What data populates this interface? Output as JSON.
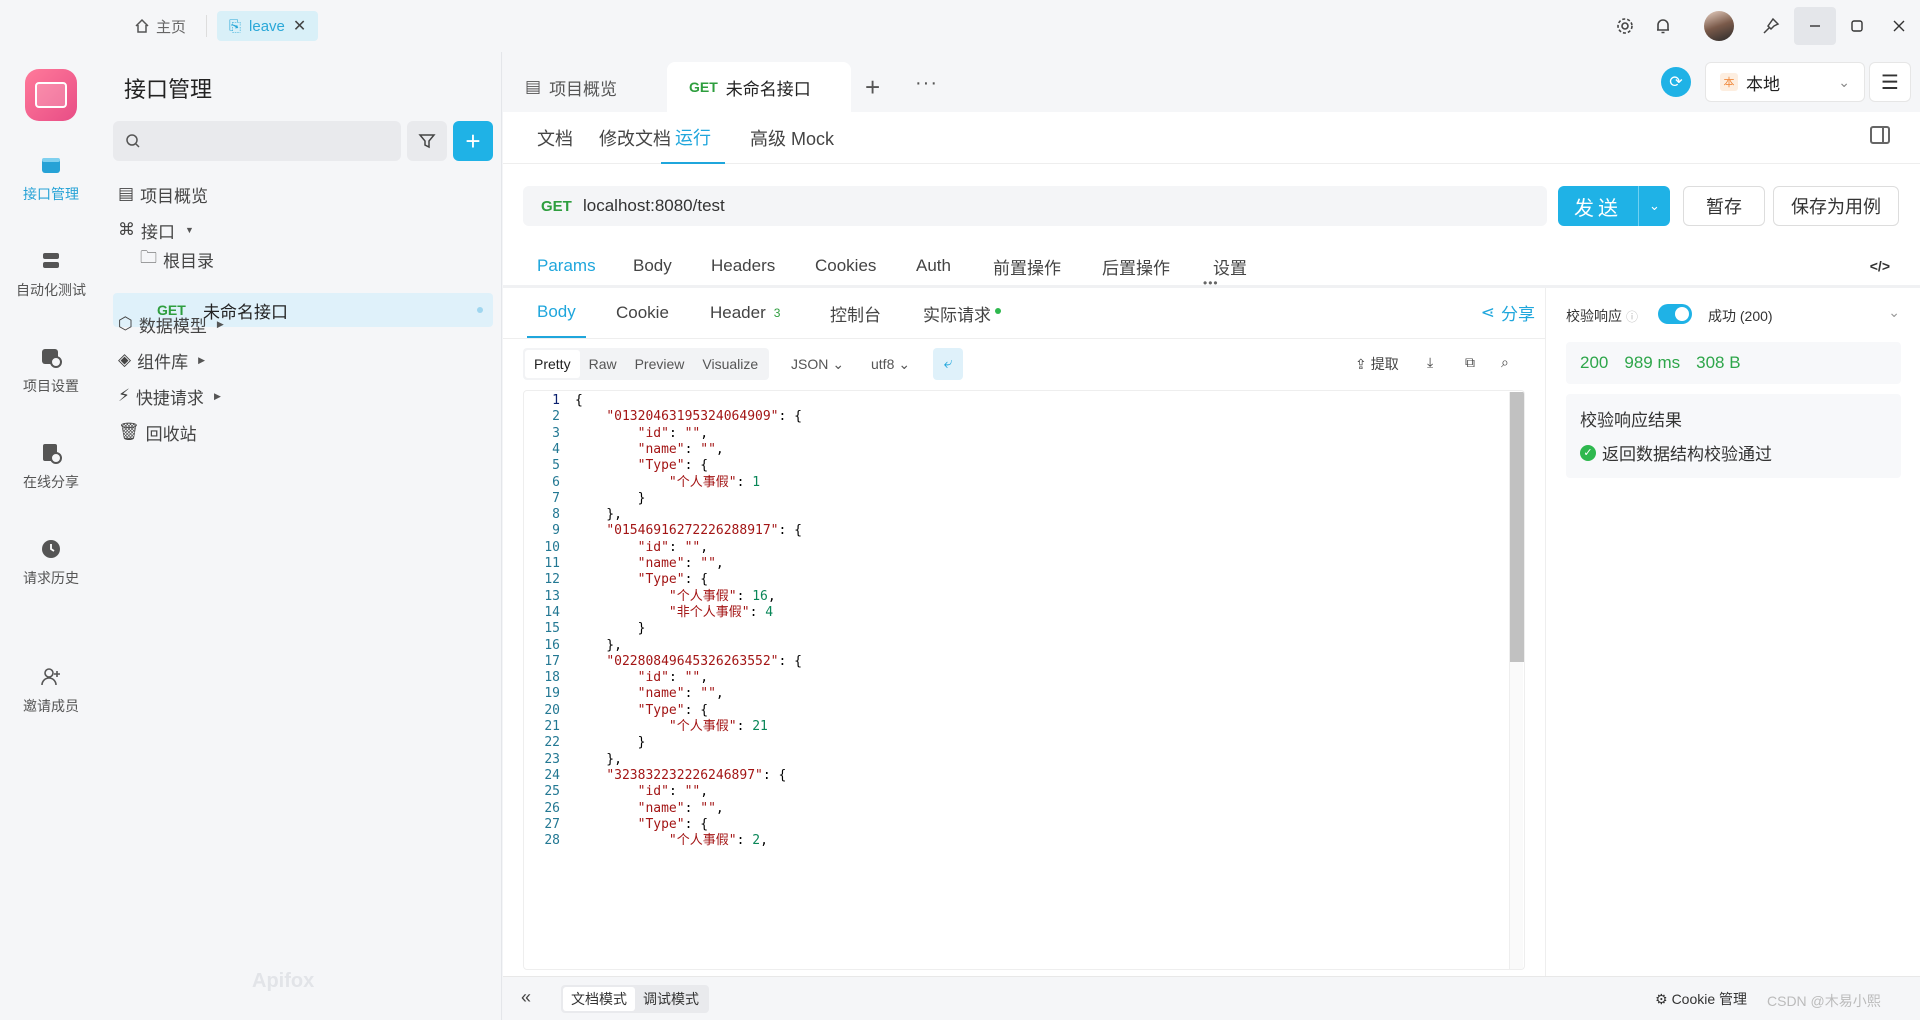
{
  "titlebar": {
    "home_label": "主页",
    "tab_label": "leave",
    "tab_close": "✕"
  },
  "leftnav": {
    "items": [
      {
        "label": "接口管理",
        "icon": "api-icon"
      },
      {
        "label": "自动化测试",
        "icon": "automation-icon"
      },
      {
        "label": "项目设置",
        "icon": "project-settings-icon"
      },
      {
        "label": "在线分享",
        "icon": "share-doc-icon"
      },
      {
        "label": "请求历史",
        "icon": "history-icon"
      },
      {
        "label": "邀请成员",
        "icon": "invite-user-icon"
      }
    ]
  },
  "sidebar": {
    "title": "接口管理",
    "search_placeholder": "",
    "add_label": "+",
    "tree": [
      {
        "label": "项目概览"
      },
      {
        "label": "接口"
      },
      {
        "label": "根目录"
      },
      {
        "label": "数据模型"
      },
      {
        "label": "组件库"
      },
      {
        "label": "快捷请求"
      },
      {
        "label": "回收站"
      }
    ],
    "selected": {
      "method": "GET",
      "name": "未命名接口"
    },
    "watermark": "Apifox"
  },
  "topbar": {
    "tab_overview": "项目概览",
    "tab_active_method": "GET",
    "tab_active_name": "未命名接口",
    "plus": "+",
    "more": "···",
    "env": {
      "badge": "本",
      "label": "本地"
    }
  },
  "subtabs": [
    "文档",
    "修改文档",
    "运行",
    "高级 Mock"
  ],
  "request": {
    "method": "GET",
    "url": "localhost:8080/test",
    "send": "发送",
    "save_temp": "暂存",
    "save_case": "保存为用例"
  },
  "reqtabs": [
    "Params",
    "Body",
    "Headers",
    "Cookies",
    "Auth",
    "前置操作",
    "后置操作",
    "设置"
  ],
  "response": {
    "tabs": [
      "Body",
      "Cookie",
      "Header",
      "控制台",
      "实际请求"
    ],
    "header_count": "3",
    "share": "分享",
    "formats": [
      "Pretty",
      "Raw",
      "Preview",
      "Visualize"
    ],
    "lang": "JSON",
    "encoding": "utf8",
    "extract": "提取",
    "code": [
      [
        {
          "t": "{"
        }
      ],
      [
        {
          "t": "    "
        },
        {
          "t": "\"013204631953240649​09\"",
          "c": "k"
        },
        {
          "t": ": {"
        }
      ],
      [
        {
          "t": "        "
        },
        {
          "t": "\"id\"",
          "c": "k"
        },
        {
          "t": ": "
        },
        {
          "t": "\"\"",
          "c": "k"
        },
        {
          "t": ","
        }
      ],
      [
        {
          "t": "        "
        },
        {
          "t": "\"name\"",
          "c": "k"
        },
        {
          "t": ": "
        },
        {
          "t": "\"\"",
          "c": "k"
        },
        {
          "t": ","
        }
      ],
      [
        {
          "t": "        "
        },
        {
          "t": "\"Type\"",
          "c": "k"
        },
        {
          "t": ": {"
        }
      ],
      [
        {
          "t": "            "
        },
        {
          "t": "\"个人事假\"",
          "c": "k"
        },
        {
          "t": ": "
        },
        {
          "t": "1",
          "c": "n"
        }
      ],
      [
        {
          "t": "        }"
        }
      ],
      [
        {
          "t": "    },"
        }
      ],
      [
        {
          "t": "    "
        },
        {
          "t": "\"01546916272226288917\"",
          "c": "k"
        },
        {
          "t": ": {"
        }
      ],
      [
        {
          "t": "        "
        },
        {
          "t": "\"id\"",
          "c": "k"
        },
        {
          "t": ": "
        },
        {
          "t": "\"\"",
          "c": "k"
        },
        {
          "t": ","
        }
      ],
      [
        {
          "t": "        "
        },
        {
          "t": "\"name\"",
          "c": "k"
        },
        {
          "t": ": "
        },
        {
          "t": "\"\"",
          "c": "k"
        },
        {
          "t": ","
        }
      ],
      [
        {
          "t": "        "
        },
        {
          "t": "\"Type\"",
          "c": "k"
        },
        {
          "t": ": {"
        }
      ],
      [
        {
          "t": "            "
        },
        {
          "t": "\"个人事假\"",
          "c": "k"
        },
        {
          "t": ": "
        },
        {
          "t": "16",
          "c": "n"
        },
        {
          "t": ","
        }
      ],
      [
        {
          "t": "            "
        },
        {
          "t": "\"非个人事假\"",
          "c": "k"
        },
        {
          "t": ": "
        },
        {
          "t": "4",
          "c": "n"
        }
      ],
      [
        {
          "t": "        }"
        }
      ],
      [
        {
          "t": "    },"
        }
      ],
      [
        {
          "t": "    "
        },
        {
          "t": "\"02280849645326263552\"",
          "c": "k"
        },
        {
          "t": ": {"
        }
      ],
      [
        {
          "t": "        "
        },
        {
          "t": "\"id\"",
          "c": "k"
        },
        {
          "t": ": "
        },
        {
          "t": "\"\"",
          "c": "k"
        },
        {
          "t": ","
        }
      ],
      [
        {
          "t": "        "
        },
        {
          "t": "\"name\"",
          "c": "k"
        },
        {
          "t": ": "
        },
        {
          "t": "\"\"",
          "c": "k"
        },
        {
          "t": ","
        }
      ],
      [
        {
          "t": "        "
        },
        {
          "t": "\"Type\"",
          "c": "k"
        },
        {
          "t": ": {"
        }
      ],
      [
        {
          "t": "            "
        },
        {
          "t": "\"个人事假\"",
          "c": "k"
        },
        {
          "t": ": "
        },
        {
          "t": "21",
          "c": "n"
        }
      ],
      [
        {
          "t": "        }"
        }
      ],
      [
        {
          "t": "    },"
        }
      ],
      [
        {
          "t": "    "
        },
        {
          "t": "\"323832232226246897\"",
          "c": "k"
        },
        {
          "t": ": {"
        }
      ],
      [
        {
          "t": "        "
        },
        {
          "t": "\"id\"",
          "c": "k"
        },
        {
          "t": ": "
        },
        {
          "t": "\"\"",
          "c": "k"
        },
        {
          "t": ","
        }
      ],
      [
        {
          "t": "        "
        },
        {
          "t": "\"name\"",
          "c": "k"
        },
        {
          "t": ": "
        },
        {
          "t": "\"\"",
          "c": "k"
        },
        {
          "t": ","
        }
      ],
      [
        {
          "t": "        "
        },
        {
          "t": "\"Type\"",
          "c": "k"
        },
        {
          "t": ": {"
        }
      ],
      [
        {
          "t": "            "
        },
        {
          "t": "\"个人事假\"",
          "c": "k"
        },
        {
          "t": ": "
        },
        {
          "t": "2",
          "c": "n"
        },
        {
          "t": ","
        }
      ]
    ]
  },
  "validation": {
    "label": "校验响应",
    "status": "成功 (200)",
    "code": "200",
    "time": "989 ms",
    "size": "308 B",
    "result_title": "校验响应结果",
    "result_text": "返回数据结构校验通过"
  },
  "bottombar": {
    "collapse": "«",
    "modes": [
      "文档模式",
      "调试模式"
    ],
    "cookie": "Cookie 管理",
    "watermark": "CSDN @木易小熙"
  },
  "colors": {
    "accent": "#1fb2e6",
    "get_method": "#2e9e3e",
    "success": "#2eb84e"
  }
}
